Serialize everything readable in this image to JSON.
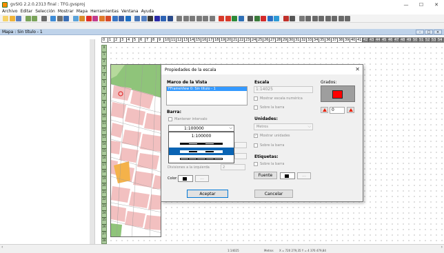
{
  "window": {
    "title": "gvSIG 2.2.0.2313 final : TFG.gvsproj",
    "minimize": "—",
    "maximize": "☐",
    "close": "✕"
  },
  "menubar": {
    "items": [
      "Archivo",
      "Editar",
      "Selección",
      "Mostrar",
      "Mapa",
      "Herramientas",
      "Ventana",
      "Ayuda"
    ]
  },
  "toolbar": {
    "icons": [
      {
        "name": "new-icon",
        "color": "#f6d36b"
      },
      {
        "name": "open-icon",
        "color": "#f0b33a"
      },
      {
        "name": "save-icon",
        "color": "#5a7fbf"
      },
      {
        "name": "sep"
      },
      {
        "name": "layers-icon",
        "color": "#7aa35a"
      },
      {
        "name": "layers2-icon",
        "color": "#7aa35a"
      },
      {
        "name": "sep"
      },
      {
        "name": "select-icon",
        "color": "#6a6a6a"
      },
      {
        "name": "sep"
      },
      {
        "name": "move-icon",
        "color": "#3d8bd6"
      },
      {
        "name": "grid-icon",
        "color": "#6f6f6f"
      },
      {
        "name": "measure-icon",
        "color": "#3b6fb6"
      },
      {
        "name": "sep"
      },
      {
        "name": "insert-view-icon",
        "color": "#5aa3d9"
      },
      {
        "name": "insert-image-icon",
        "color": "#d98b2b"
      },
      {
        "name": "draw-icon",
        "color": "#e0302a"
      },
      {
        "name": "line-icon",
        "color": "#c23c8e"
      },
      {
        "name": "point-icon",
        "color": "#e07a2a"
      },
      {
        "name": "polygon-icon",
        "color": "#d84a2a"
      },
      {
        "name": "text-icon",
        "color": "#3a75c4"
      },
      {
        "name": "rect-icon",
        "color": "#3a5fa6"
      },
      {
        "name": "circle-icon",
        "color": "#1d6fc4"
      },
      {
        "name": "sep"
      },
      {
        "name": "table-icon",
        "color": "#4a78b8"
      },
      {
        "name": "grid2-icon",
        "color": "#5581c2"
      },
      {
        "name": "north-icon",
        "color": "#3a3a3a"
      },
      {
        "name": "scale-icon",
        "color": "#2a2aa8"
      },
      {
        "name": "legend-icon",
        "color": "#2d63b5"
      },
      {
        "name": "eye-icon",
        "color": "#2a4a8a"
      },
      {
        "name": "sep"
      },
      {
        "name": "zoom-in-icon",
        "color": "#7a7a7a"
      },
      {
        "name": "zoom-out-icon",
        "color": "#7a7a7a"
      },
      {
        "name": "zoom-all-icon",
        "color": "#7a7a7a"
      },
      {
        "name": "zoom-1-icon",
        "color": "#7a7a7a"
      },
      {
        "name": "pan-icon",
        "color": "#7a7a7a"
      },
      {
        "name": "zoom-layer-icon",
        "color": "#7a7a7a"
      },
      {
        "name": "sep"
      },
      {
        "name": "select-arrow-icon",
        "color": "#d83a2a"
      },
      {
        "name": "edit-node-icon",
        "color": "#d83a2a"
      },
      {
        "name": "map-icon",
        "color": "#2d8a3a"
      },
      {
        "name": "pin-icon",
        "color": "#2d6fb6"
      },
      {
        "name": "sep"
      },
      {
        "name": "table2-icon",
        "color": "#555"
      },
      {
        "name": "layout-icon",
        "color": "#3a7a3a"
      },
      {
        "name": "print-icon",
        "color": "#d32a2a"
      },
      {
        "name": "blocks-icon",
        "color": "#2a6fc4"
      },
      {
        "name": "add-icon",
        "color": "#2d9ad6"
      },
      {
        "name": "sep"
      },
      {
        "name": "info-icon",
        "color": "#c0302a"
      },
      {
        "name": "tools-icon",
        "color": "#555"
      },
      {
        "name": "sep"
      },
      {
        "name": "refresh-icon",
        "color": "#7a7a7a"
      },
      {
        "name": "zoomc1-icon",
        "color": "#6a6a6a"
      },
      {
        "name": "zoomc2-icon",
        "color": "#6a6a6a"
      },
      {
        "name": "zoomc3-icon",
        "color": "#6a6a6a"
      },
      {
        "name": "zoomc4-icon",
        "color": "#6a6a6a"
      },
      {
        "name": "zoomc5-icon",
        "color": "#6a6a6a"
      },
      {
        "name": "zoomc6-icon",
        "color": "#6a6a6a"
      },
      {
        "name": "zoomc7-icon",
        "color": "#6a6a6a"
      }
    ]
  },
  "mapwindow": {
    "title": "Mapa : Sin título - 1",
    "ruler_top": [
      "0",
      "1",
      "2",
      "3",
      "4",
      "5",
      "6",
      "7",
      "8",
      "9",
      "10",
      "11",
      "12",
      "13",
      "14",
      "15",
      "16",
      "17",
      "18",
      "19",
      "20",
      "21",
      "22",
      "23",
      "24",
      "25",
      "26",
      "27",
      "28",
      "29",
      "30",
      "31",
      "32",
      "33",
      "34",
      "35",
      "36",
      "37",
      "38",
      "39",
      "40",
      "41",
      "42",
      "43",
      "44",
      "45",
      "46",
      "47",
      "48",
      "49",
      "50",
      "51",
      "52",
      "53",
      "54"
    ],
    "ruler_left": [
      "0",
      "1",
      "2",
      "3",
      "4",
      "5",
      "6",
      "7",
      "8",
      "9",
      "10",
      "11",
      "12",
      "13",
      "14",
      "15",
      "16",
      "17",
      "18",
      "19",
      "20",
      "21",
      "22",
      "23",
      "24",
      "25",
      "26",
      "27",
      "28"
    ]
  },
  "dialog": {
    "title": "Propiedades de la escala",
    "close": "✕",
    "marco_label": "Marco de la Vista",
    "marco_item": "FFrameView 0: Sin título - 1",
    "escala_label": "Escala",
    "escala_value": "1:14025",
    "grados_label": "Grados:",
    "grados_value": "0",
    "mostrar_escala_numerica": "Mostrar escala numérica",
    "sobre_la_barra_1": "Sobre la barra",
    "barra_label": "Barra:",
    "mantener_intervalo": "Mantener intervalo",
    "combo_value": "1:100000",
    "dropdown_first": "1:100000",
    "unidades_label": "Unidades:",
    "unidades_value": "Metros",
    "mostrar_unidades": "Mostrar unidades",
    "sobre_la_barra_2": "Sobre la barra",
    "divisiones_label": "Divisiones a la izquierda",
    "divisiones_value": "2",
    "etiquetas_label": "Etiquetas:",
    "sobre_la_barra_3": "Sobre la barra",
    "fuente_button": "Fuente",
    "color_label": "Color:",
    "dots_button": "...",
    "aceptar_button": "Aceptar",
    "cancelar_button": "Cancelar",
    "check_mark": "✓"
  },
  "statusbar": {
    "scale": "1:14025",
    "units": "Metros",
    "coords": "X = 720 279,35 Y = 4 376 479,84"
  },
  "scroll": {
    "left": "‹",
    "right": "›"
  }
}
